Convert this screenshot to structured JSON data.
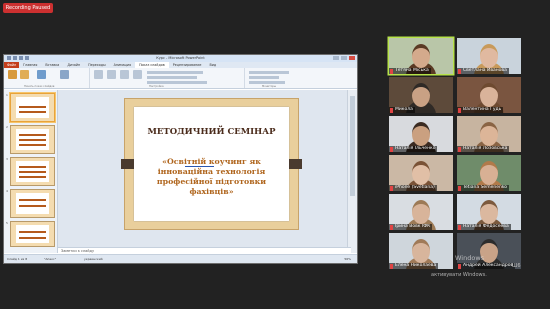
{
  "recording": {
    "label": "Recording Paused"
  },
  "powerpoint": {
    "window_title": "Курс - Microsoft PowerPoint",
    "tabs": [
      {
        "label": "Файл"
      },
      {
        "label": "Главная"
      },
      {
        "label": "Вставка"
      },
      {
        "label": "Дизайн"
      },
      {
        "label": "Переходы"
      },
      {
        "label": "Анимация"
      },
      {
        "label": "Показ слайдов"
      },
      {
        "label": "Рецензирование"
      },
      {
        "label": "Вид"
      }
    ],
    "active_tab": "Показ слайдов",
    "ribbon_groups": [
      {
        "label": "Начать показ слайдов"
      },
      {
        "label": "Настройка"
      },
      {
        "label": "Мониторы"
      }
    ],
    "slide": {
      "title": "МЕТОДИЧНИЙ СЕМІНАР",
      "body": "«Освітній коучинг як інноваційна технологія професійної підготовки фахівців»",
      "underlined_word": "коучинг"
    },
    "thumbnails": [
      {
        "num": "1"
      },
      {
        "num": "2"
      },
      {
        "num": "3"
      },
      {
        "num": "4"
      },
      {
        "num": "5"
      }
    ],
    "notes_placeholder": "Заметки к слайду",
    "status": {
      "slide_info": "Слайд 1 из 8",
      "theme": "\"Апекс\"",
      "language": "украинский",
      "zoom": "56%"
    }
  },
  "participants": [
    {
      "name": "Тетяна Міська",
      "muted": true,
      "active": true,
      "bg": "#b9c6a8",
      "skin": "#d4aa8c",
      "hair": "#5a3a24"
    },
    {
      "name": "Светлана Иванова",
      "muted": true,
      "active": false,
      "bg": "#c9d3dc",
      "skin": "#e0b9a0",
      "hair": "#c89a5a"
    },
    {
      "name": "Микола",
      "muted": true,
      "active": false,
      "bg": "#5d4a3a",
      "skin": "#c9a184",
      "hair": "#2f2a26"
    },
    {
      "name": "Валентина Гудь",
      "muted": true,
      "active": false,
      "bg": "#7a5540",
      "skin": "#d9b39a",
      "hair": "#6e4a30"
    },
    {
      "name": "Наталія Ільченко",
      "muted": true,
      "active": false,
      "bg": "#d8dade",
      "skin": "#caa080",
      "hair": "#3b2b22"
    },
    {
      "name": "Наталія Лозовська",
      "muted": true,
      "active": false,
      "bg": "#c7b4a0",
      "skin": "#dcb598",
      "hair": "#8a6444"
    },
    {
      "name": "iPhone (Svetlana)",
      "muted": true,
      "active": false,
      "bg": "#cbb8a5",
      "skin": "#e1bfa6",
      "hair": "#7a5236"
    },
    {
      "name": "Tetiana Semenenko",
      "muted": true,
      "active": false,
      "bg": "#6f8c6a",
      "skin": "#d8b094",
      "hair": "#b07a4a"
    },
    {
      "name": "Ірина Вовк ІФК",
      "muted": true,
      "active": false,
      "bg": "#d9dde2",
      "skin": "#d8b49a",
      "hair": "#9c7a56"
    },
    {
      "name": "Наталія Федосеева",
      "muted": true,
      "active": false,
      "bg": "#d3dbe3",
      "skin": "#dbb89f",
      "hair": "#7c5a3e"
    },
    {
      "name": "Елена Николаева",
      "muted": true,
      "active": false,
      "bg": "#cfd6dc",
      "skin": "#d8b59c",
      "hair": "#a07a58"
    },
    {
      "name": "Андрей Александров",
      "muted": true,
      "active": false,
      "bg": "#4a5058",
      "skin": "#c9a388",
      "hair": "#2c2c2c"
    }
  ],
  "watermark": {
    "line1": "Windows",
    "line2": "активувати Windows."
  },
  "truncated_text": "Ш6"
}
